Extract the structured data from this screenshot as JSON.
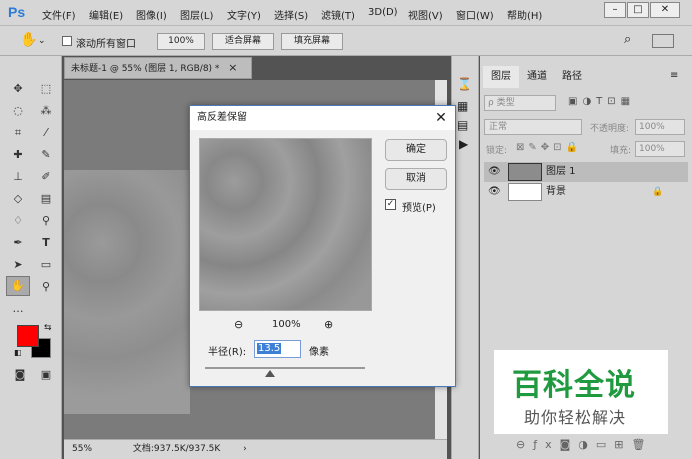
{
  "app": {
    "logo": "Ps"
  },
  "menu": [
    "文件(F)",
    "编辑(E)",
    "图像(I)",
    "图层(L)",
    "文字(Y)",
    "选择(S)",
    "滤镜(T)",
    "3D(D)",
    "视图(V)",
    "窗口(W)",
    "帮助(H)"
  ],
  "options": {
    "scroll_all_label": "滚动所有窗口",
    "zoom_100": "100%",
    "fit_screen": "适合屏幕",
    "fill_screen": "填充屏幕"
  },
  "document": {
    "tab_title": "未标题-1 @ 55% (图层 1, RGB/8) *",
    "close": "×",
    "zoom": "55%",
    "doc_info": "文档:937.5K/937.5K"
  },
  "layers_panel": {
    "tabs": [
      "图层",
      "通道",
      "路径"
    ],
    "filter_label": "ρ 类型",
    "blend_mode": "正常",
    "opacity_label": "不透明度:",
    "opacity_value": "100%",
    "lock_label": "锁定:",
    "fill_label": "填充:",
    "fill_value": "100%",
    "layers": [
      {
        "name": "图层 1"
      },
      {
        "name": "背景"
      }
    ]
  },
  "dialog": {
    "title": "高反差保留",
    "ok": "确定",
    "cancel": "取消",
    "preview_label": "预览(P)",
    "zoom_value": "100%",
    "radius_label": "半径(R):",
    "radius_value": "13.5",
    "radius_unit": "像素"
  },
  "watermark": {
    "line1": "百科全说",
    "line2": "助你轻松解决"
  },
  "colors": {
    "foreground": "#ff0000",
    "background": "#000000"
  }
}
